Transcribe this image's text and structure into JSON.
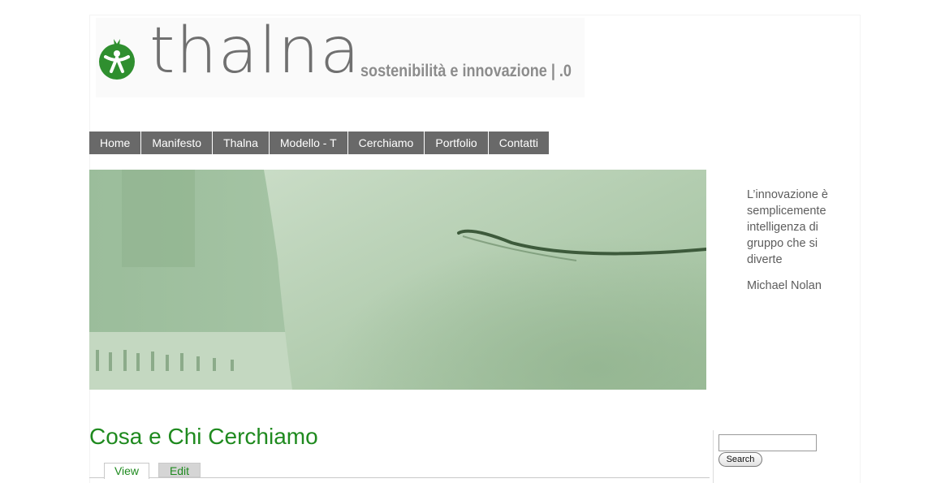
{
  "header": {
    "logo_text": "thalna",
    "tagline": "sostenibilità e innovazione | .0"
  },
  "nav": {
    "items": [
      {
        "label": "Home"
      },
      {
        "label": "Manifesto"
      },
      {
        "label": "Thalna"
      },
      {
        "label": "Modello - T"
      },
      {
        "label": "Cerchiamo"
      },
      {
        "label": "Portfolio"
      },
      {
        "label": "Contatti"
      }
    ]
  },
  "sidebar": {
    "quote": "L’innovazione è semplicemente intelligenza di gruppo che si diverte",
    "author": "Michael Nolan",
    "search_button": "Search",
    "search_value": ""
  },
  "main": {
    "title": "Cosa e Chi Cerchiamo",
    "tabs": [
      {
        "label": "View",
        "active": true
      },
      {
        "label": "Edit",
        "active": false
      }
    ]
  },
  "colors": {
    "brand_green": "#2e8b2e",
    "title_green": "#1f8a1f",
    "nav_bg": "#696969"
  }
}
